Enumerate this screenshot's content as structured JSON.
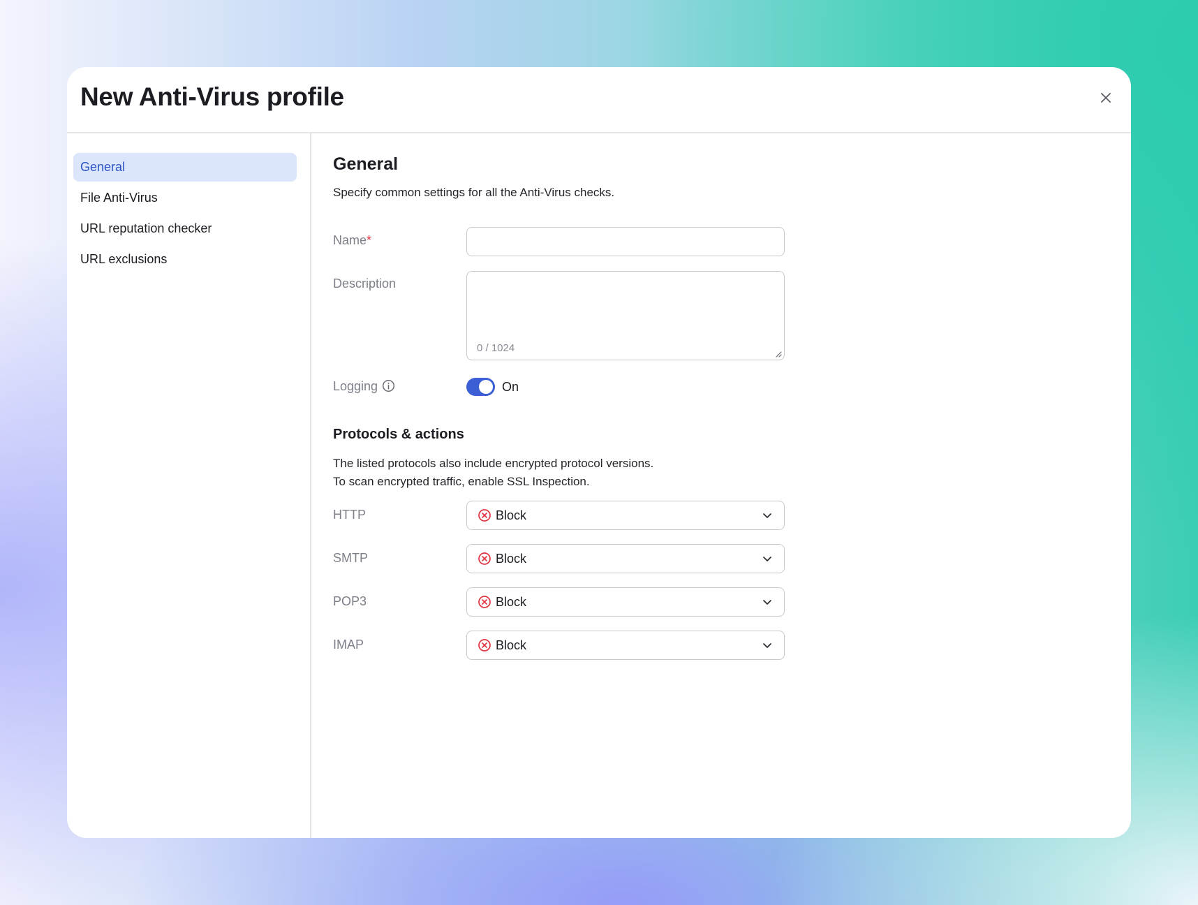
{
  "dialog": {
    "title": "New Anti-Virus profile",
    "close_icon": "close-icon"
  },
  "sidebar": {
    "items": [
      {
        "label": "General",
        "active": true
      },
      {
        "label": "File Anti-Virus",
        "active": false
      },
      {
        "label": "URL reputation checker",
        "active": false
      },
      {
        "label": "URL exclusions",
        "active": false
      }
    ]
  },
  "general": {
    "title": "General",
    "description": "Specify common settings for all the Anti-Virus checks.",
    "name": {
      "label": "Name",
      "required_marker": "*",
      "value": "",
      "placeholder": ""
    },
    "description_field": {
      "label": "Description",
      "value": "",
      "counter": "0 / 1024"
    },
    "logging": {
      "label": "Logging",
      "info_icon": "info-icon",
      "state_label": "On",
      "enabled": true
    }
  },
  "protocols": {
    "title": "Protocols & actions",
    "description_line1": "The listed protocols also include encrypted protocol versions.",
    "description_line2": "To scan encrypted traffic, enable SSL Inspection.",
    "items": [
      {
        "label": "HTTP",
        "action": "Block",
        "action_icon": "block-icon"
      },
      {
        "label": "SMTP",
        "action": "Block",
        "action_icon": "block-icon"
      },
      {
        "label": "POP3",
        "action": "Block",
        "action_icon": "block-icon"
      },
      {
        "label": "IMAP",
        "action": "Block",
        "action_icon": "block-icon"
      }
    ]
  },
  "colors": {
    "accent": "#3d5fd6",
    "active_nav_bg": "#dbe5fc",
    "active_nav_text": "#2f56c5",
    "block_red": "#e0353e",
    "required_red": "#e0353e"
  }
}
